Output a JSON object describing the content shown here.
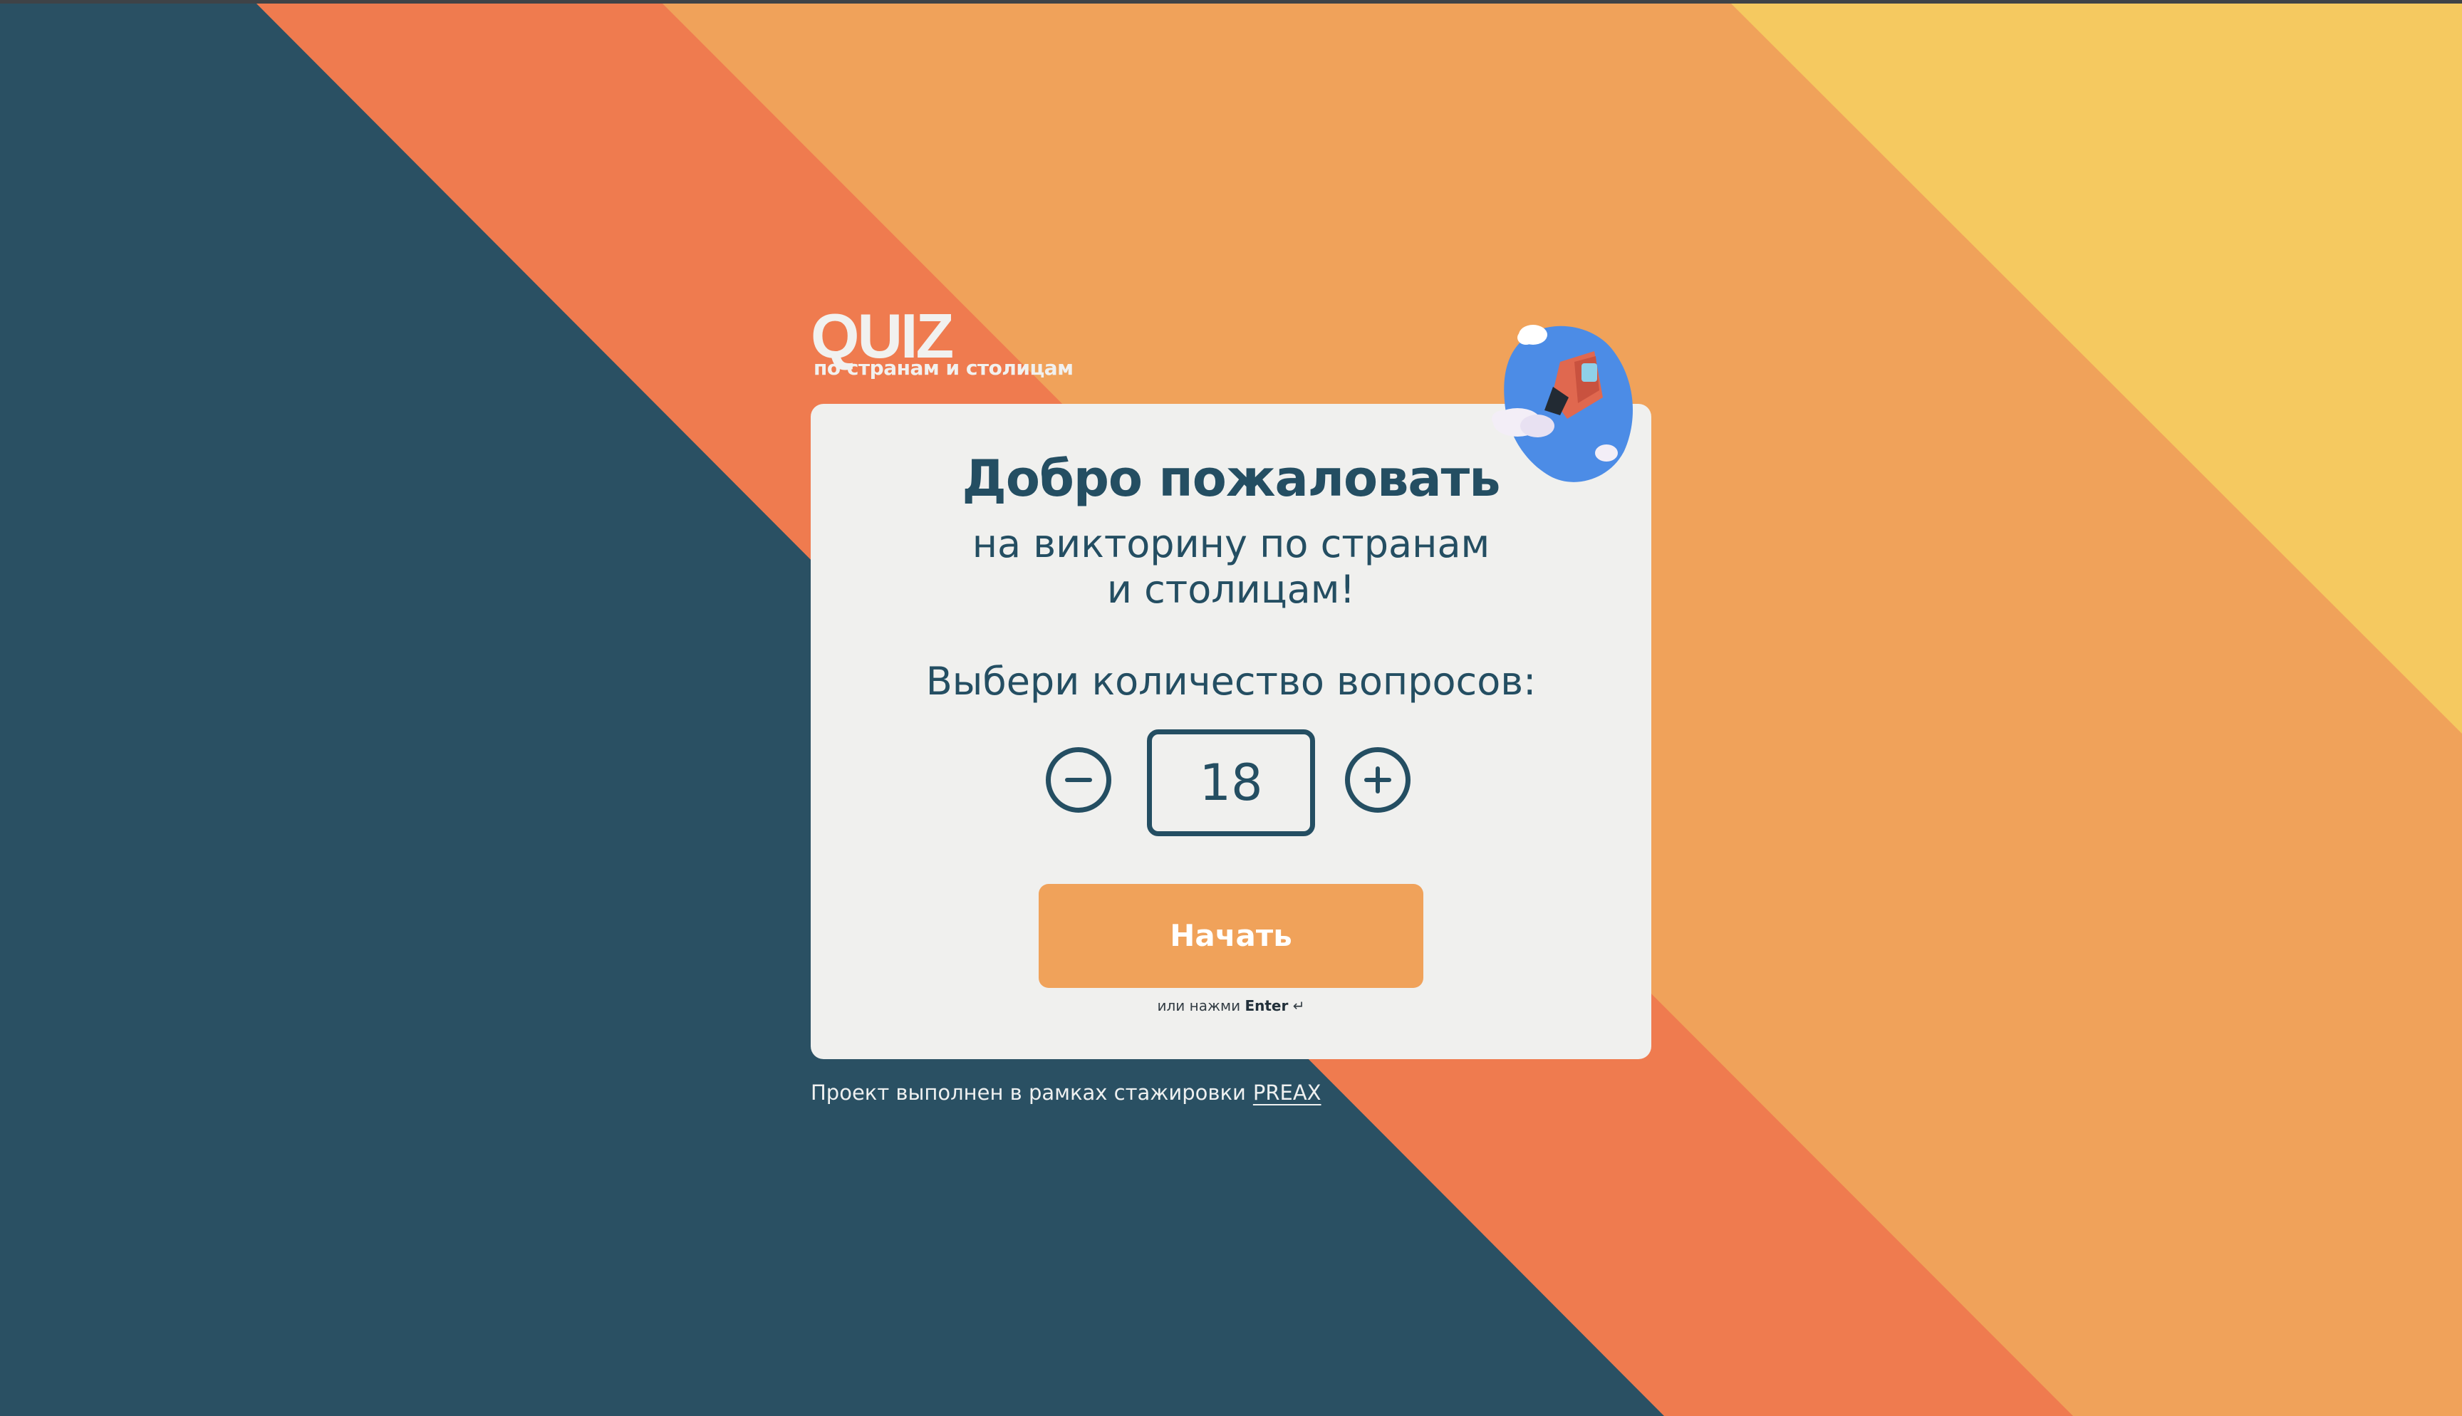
{
  "colors": {
    "dark_teal": "#2a5063",
    "coral": "#ef7b4f",
    "orange": "#f0a25a",
    "yellow": "#f5c960",
    "card_bg": "#f0f0ee",
    "text_primary": "#244e62",
    "button_text": "#ffffff"
  },
  "logo": {
    "title": "QUIZ",
    "subtitle": "по странам и столицам"
  },
  "card": {
    "title": "Добро пожаловать",
    "subtitle": "на викторину по странам\nи столицам!",
    "question_label": "Выбери количество вопросов:",
    "question_count": "18",
    "minus_icon": "minus-circle-icon",
    "plus_icon": "plus-circle-icon",
    "start_label": "Начать",
    "hint_prefix": "или нажми",
    "hint_key": "Enter",
    "hint_icon": "↵",
    "mascot_icon": "globe-rocket-mascot-icon"
  },
  "footer": {
    "text": "Проект выполнен в рамках стажировки",
    "link_label": "PREAX"
  }
}
